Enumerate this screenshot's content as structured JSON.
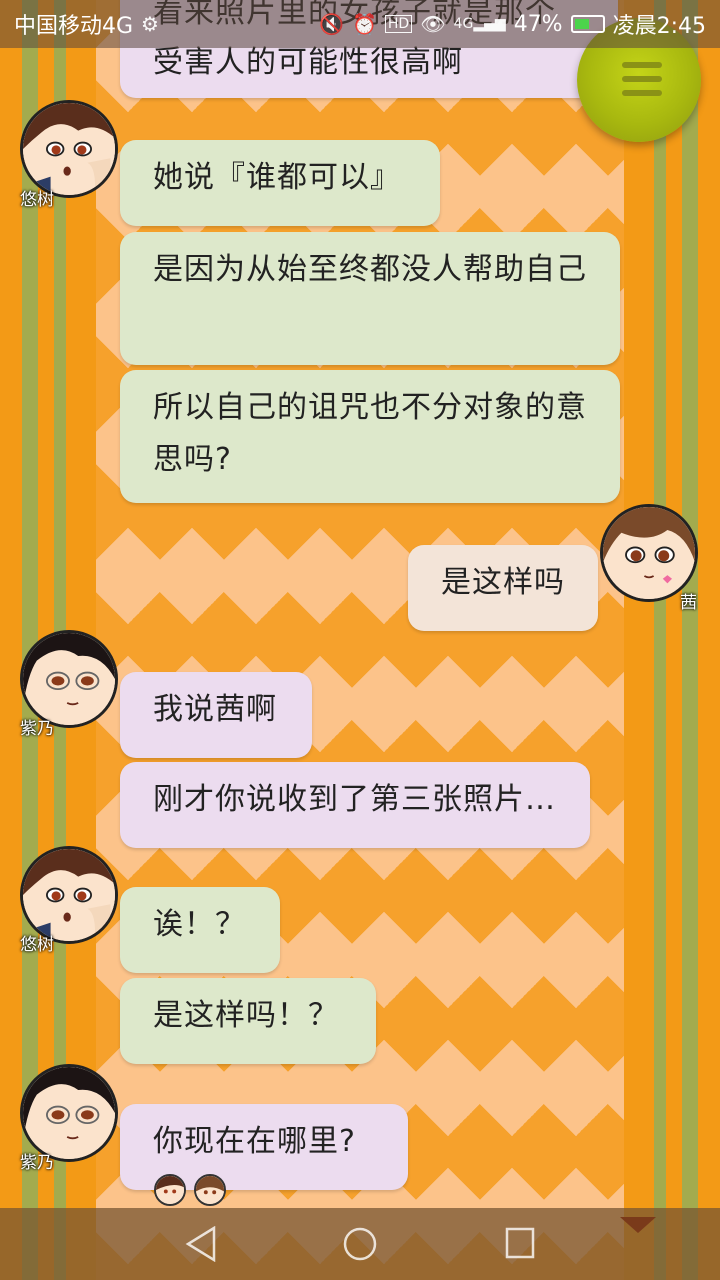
{
  "status_bar": {
    "carrier": "中国移动4G",
    "battery_percent": "47%",
    "time": "凌晨2:45",
    "network_label": "4G",
    "icons": [
      "usb-icon",
      "mute-icon",
      "alarm-icon",
      "hd-icon",
      "eye-icon",
      "signal-icon",
      "battery-icon"
    ]
  },
  "menu_button": {
    "icon": "hamburger-menu-icon"
  },
  "messages": [
    {
      "speaker": "",
      "text": "看来照片里的女孩子就是那个受害人的可能性很高啊",
      "color": "#ecdcef"
    },
    {
      "speaker": "悠树",
      "text": "她说『谁都可以』",
      "color": "#dde8cb"
    },
    {
      "speaker": "悠树",
      "text": "是因为从始至终都没人帮助自己",
      "color": "#dde8cb"
    },
    {
      "speaker": "悠树",
      "text": "所以自己的诅咒也不分对象的意思吗?",
      "color": "#dde8cb"
    },
    {
      "speaker": "茜",
      "text": "是这样吗",
      "color": "#f3e4d8"
    },
    {
      "speaker": "紫乃",
      "text": "我说茜啊",
      "color": "#ecdcef"
    },
    {
      "speaker": "紫乃",
      "text": "刚才你说收到了第三张照片…",
      "color": "#ecdcef"
    },
    {
      "speaker": "悠树",
      "text": "诶！？",
      "color": "#dde8cb"
    },
    {
      "speaker": "悠树",
      "text": "是这样吗！？",
      "color": "#dde8cb"
    },
    {
      "speaker": "紫乃",
      "text": "你现在在哪里?",
      "color": "#ecdcef"
    }
  ],
  "avatar_labels": {
    "yuki": "悠树",
    "akane": "茜",
    "shino": "紫乃"
  },
  "nav": {
    "back_icon": "back-triangle-icon",
    "home_icon": "home-circle-icon",
    "recents_icon": "recents-square-icon"
  }
}
